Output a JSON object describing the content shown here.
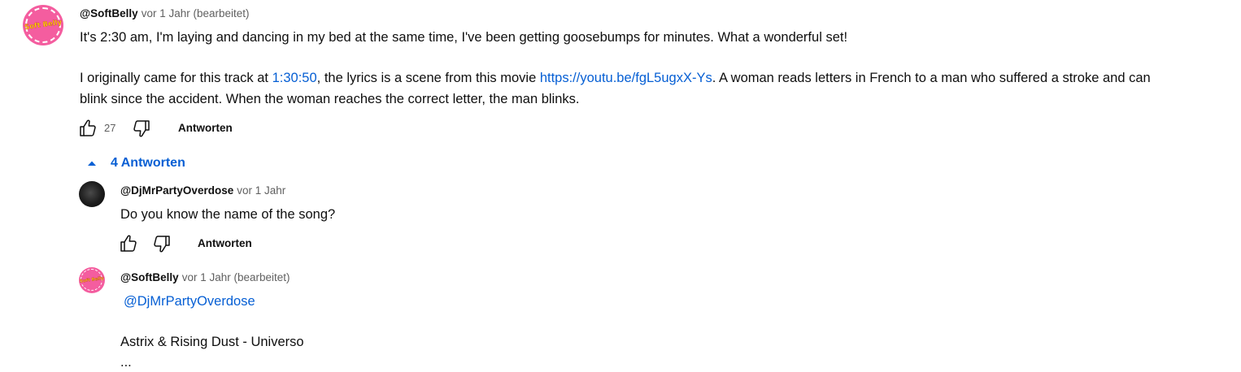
{
  "comment": {
    "avatar_text": "Soft Belly",
    "author": "@SoftBelly",
    "time": "vor 1 Jahr (bearbeitet)",
    "line1": "It's 2:30 am, I'm laying and dancing in my bed at the same time, I've been getting goosebumps for minutes. What a wonderful set!",
    "line2_a": "I originally came for this track at ",
    "timestamp_link": "1:30:50",
    "line2_b": ", the lyrics is a scene from this movie ",
    "url_link": "https://youtu.be/fgL5ugxX-Ys",
    "line2_c": ". A woman reads letters in French to a man who suffered a stroke and can",
    "line3": "blink since the accident. When the woman reaches the correct letter, the man blinks.",
    "likes": "27",
    "reply_label": "Antworten",
    "replies_toggle": "4 Antworten"
  },
  "replies": [
    {
      "author": "@DjMrPartyOverdose",
      "time": "vor 1 Jahr",
      "text": "Do you know the name of the song?",
      "reply_label": "Antworten"
    },
    {
      "avatar_text": "Soft Belly",
      "author": "@SoftBelly",
      "time": "vor 1 Jahr (bearbeitet)",
      "mention": "@DjMrPartyOverdose",
      "text": "Astrix & Rising Dust - Universo",
      "ellipsis": "..."
    }
  ],
  "colors": {
    "link": "#065fd4",
    "secondary_text": "#606060",
    "avatar_pink": "#f45d9f"
  },
  "icons": [
    "thumbs-up-icon",
    "thumbs-down-icon",
    "chevron-up-icon"
  ]
}
